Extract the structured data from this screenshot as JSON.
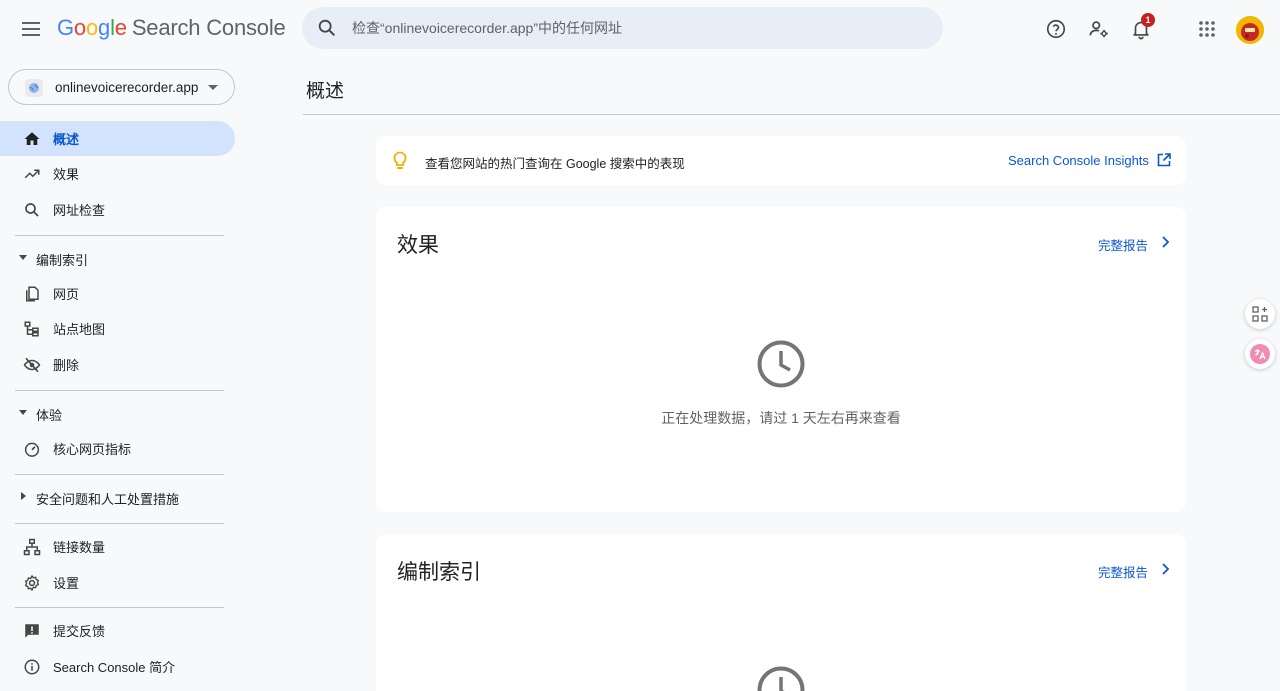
{
  "header": {
    "logo": [
      "G",
      "o",
      "o",
      "g",
      "l",
      "e"
    ],
    "product": "Search Console",
    "search_placeholder": "检查“onlinevoicerecorder.app”中的任何网址",
    "notification_count": "1"
  },
  "property": {
    "name": "onlinevoicerecorder.app"
  },
  "sidebar": {
    "overview": "概述",
    "performance": "效果",
    "url_inspection": "网址检查",
    "indexing": "编制索引",
    "pages": "网页",
    "sitemaps": "站点地图",
    "removals": "删除",
    "experience": "体验",
    "core_web_vitals": "核心网页指标",
    "security": "安全问题和人工处置措施",
    "links": "链接数量",
    "settings": "设置",
    "feedback": "提交反馈",
    "about": "Search Console 简介"
  },
  "main": {
    "title": "概述",
    "insight_text": "查看您网站的热门查询在 Google 搜索中的表现",
    "insight_link": "Search Console Insights",
    "performance_card": {
      "title": "效果",
      "link": "完整报告",
      "status": "正在处理数据，请过 1 天左右再来查看"
    },
    "indexing_card": {
      "title": "编制索引",
      "link": "完整报告"
    }
  },
  "colors": {
    "accent": "#0b57d0",
    "active_bg": "#d3e3fd",
    "search_bg": "#e8eef7",
    "badge": "#c5221f"
  }
}
